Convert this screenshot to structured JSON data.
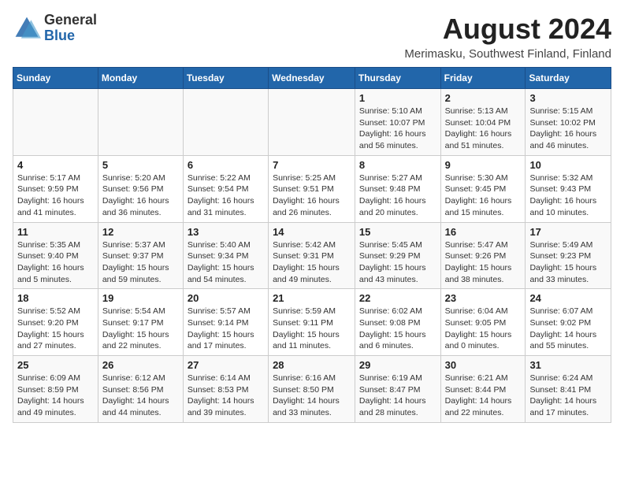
{
  "header": {
    "logo_general": "General",
    "logo_blue": "Blue",
    "month_year": "August 2024",
    "location": "Merimasku, Southwest Finland, Finland"
  },
  "days_of_week": [
    "Sunday",
    "Monday",
    "Tuesday",
    "Wednesday",
    "Thursday",
    "Friday",
    "Saturday"
  ],
  "weeks": [
    [
      {
        "day": "",
        "info": ""
      },
      {
        "day": "",
        "info": ""
      },
      {
        "day": "",
        "info": ""
      },
      {
        "day": "",
        "info": ""
      },
      {
        "day": "1",
        "info": "Sunrise: 5:10 AM\nSunset: 10:07 PM\nDaylight: 16 hours\nand 56 minutes."
      },
      {
        "day": "2",
        "info": "Sunrise: 5:13 AM\nSunset: 10:04 PM\nDaylight: 16 hours\nand 51 minutes."
      },
      {
        "day": "3",
        "info": "Sunrise: 5:15 AM\nSunset: 10:02 PM\nDaylight: 16 hours\nand 46 minutes."
      }
    ],
    [
      {
        "day": "4",
        "info": "Sunrise: 5:17 AM\nSunset: 9:59 PM\nDaylight: 16 hours\nand 41 minutes."
      },
      {
        "day": "5",
        "info": "Sunrise: 5:20 AM\nSunset: 9:56 PM\nDaylight: 16 hours\nand 36 minutes."
      },
      {
        "day": "6",
        "info": "Sunrise: 5:22 AM\nSunset: 9:54 PM\nDaylight: 16 hours\nand 31 minutes."
      },
      {
        "day": "7",
        "info": "Sunrise: 5:25 AM\nSunset: 9:51 PM\nDaylight: 16 hours\nand 26 minutes."
      },
      {
        "day": "8",
        "info": "Sunrise: 5:27 AM\nSunset: 9:48 PM\nDaylight: 16 hours\nand 20 minutes."
      },
      {
        "day": "9",
        "info": "Sunrise: 5:30 AM\nSunset: 9:45 PM\nDaylight: 16 hours\nand 15 minutes."
      },
      {
        "day": "10",
        "info": "Sunrise: 5:32 AM\nSunset: 9:43 PM\nDaylight: 16 hours\nand 10 minutes."
      }
    ],
    [
      {
        "day": "11",
        "info": "Sunrise: 5:35 AM\nSunset: 9:40 PM\nDaylight: 16 hours\nand 5 minutes."
      },
      {
        "day": "12",
        "info": "Sunrise: 5:37 AM\nSunset: 9:37 PM\nDaylight: 15 hours\nand 59 minutes."
      },
      {
        "day": "13",
        "info": "Sunrise: 5:40 AM\nSunset: 9:34 PM\nDaylight: 15 hours\nand 54 minutes."
      },
      {
        "day": "14",
        "info": "Sunrise: 5:42 AM\nSunset: 9:31 PM\nDaylight: 15 hours\nand 49 minutes."
      },
      {
        "day": "15",
        "info": "Sunrise: 5:45 AM\nSunset: 9:29 PM\nDaylight: 15 hours\nand 43 minutes."
      },
      {
        "day": "16",
        "info": "Sunrise: 5:47 AM\nSunset: 9:26 PM\nDaylight: 15 hours\nand 38 minutes."
      },
      {
        "day": "17",
        "info": "Sunrise: 5:49 AM\nSunset: 9:23 PM\nDaylight: 15 hours\nand 33 minutes."
      }
    ],
    [
      {
        "day": "18",
        "info": "Sunrise: 5:52 AM\nSunset: 9:20 PM\nDaylight: 15 hours\nand 27 minutes."
      },
      {
        "day": "19",
        "info": "Sunrise: 5:54 AM\nSunset: 9:17 PM\nDaylight: 15 hours\nand 22 minutes."
      },
      {
        "day": "20",
        "info": "Sunrise: 5:57 AM\nSunset: 9:14 PM\nDaylight: 15 hours\nand 17 minutes."
      },
      {
        "day": "21",
        "info": "Sunrise: 5:59 AM\nSunset: 9:11 PM\nDaylight: 15 hours\nand 11 minutes."
      },
      {
        "day": "22",
        "info": "Sunrise: 6:02 AM\nSunset: 9:08 PM\nDaylight: 15 hours\nand 6 minutes."
      },
      {
        "day": "23",
        "info": "Sunrise: 6:04 AM\nSunset: 9:05 PM\nDaylight: 15 hours\nand 0 minutes."
      },
      {
        "day": "24",
        "info": "Sunrise: 6:07 AM\nSunset: 9:02 PM\nDaylight: 14 hours\nand 55 minutes."
      }
    ],
    [
      {
        "day": "25",
        "info": "Sunrise: 6:09 AM\nSunset: 8:59 PM\nDaylight: 14 hours\nand 49 minutes."
      },
      {
        "day": "26",
        "info": "Sunrise: 6:12 AM\nSunset: 8:56 PM\nDaylight: 14 hours\nand 44 minutes."
      },
      {
        "day": "27",
        "info": "Sunrise: 6:14 AM\nSunset: 8:53 PM\nDaylight: 14 hours\nand 39 minutes."
      },
      {
        "day": "28",
        "info": "Sunrise: 6:16 AM\nSunset: 8:50 PM\nDaylight: 14 hours\nand 33 minutes."
      },
      {
        "day": "29",
        "info": "Sunrise: 6:19 AM\nSunset: 8:47 PM\nDaylight: 14 hours\nand 28 minutes."
      },
      {
        "day": "30",
        "info": "Sunrise: 6:21 AM\nSunset: 8:44 PM\nDaylight: 14 hours\nand 22 minutes."
      },
      {
        "day": "31",
        "info": "Sunrise: 6:24 AM\nSunset: 8:41 PM\nDaylight: 14 hours\nand 17 minutes."
      }
    ]
  ]
}
